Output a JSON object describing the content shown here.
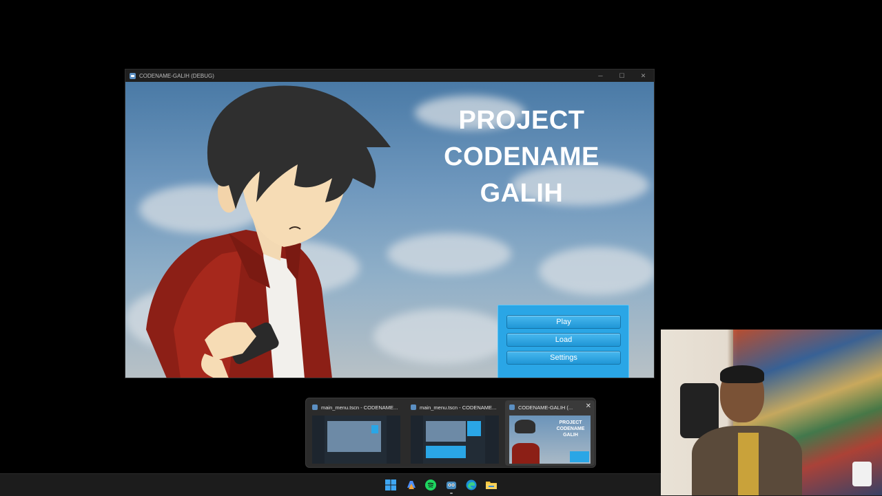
{
  "window": {
    "title": "CODENAME-GALIH (DEBUG)",
    "controls": {
      "minimize": "─",
      "maximize": "☐",
      "close": "✕"
    }
  },
  "game": {
    "title_lines": [
      "PROJECT",
      "CODENAME",
      "GALIH"
    ],
    "menu": {
      "play": "Play",
      "load": "Load",
      "settings": "Settings"
    }
  },
  "taskbar_preview": {
    "items": [
      {
        "label": "main_menu.tscn - CODENAME..."
      },
      {
        "label": "main_menu.tscn - CODENAME..."
      },
      {
        "label": "CODENAME-GALIH (...",
        "close": "✕"
      }
    ],
    "mini_game_title": [
      "PROJECT",
      "CODENAME",
      "GALIH"
    ]
  },
  "taskbar": {
    "icons": [
      "windows-start-icon",
      "copilot-icon",
      "spotify-icon",
      "godot-icon",
      "edge-icon",
      "file-explorer-icon"
    ]
  },
  "colors": {
    "menu_panel": "#2aa6e6",
    "button": "#1f96d6",
    "taskbar": "#1c1c1c"
  }
}
